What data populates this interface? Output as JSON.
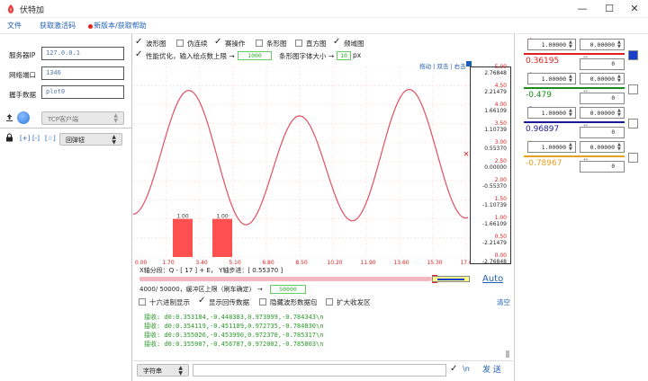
{
  "window": {
    "title": "伏特加",
    "buttons": {
      "min": "—",
      "max": "☐",
      "close": "✕"
    }
  },
  "menu": {
    "file": "文件",
    "activation": "获取激活码",
    "update": "新版本/获取帮助"
  },
  "connection": {
    "server_ip_label": "服务器IP",
    "server_ip_value": "127.0.0.1",
    "port_label": "网络端口",
    "port_value": "1346",
    "handshake_label": "握手数据",
    "handshake_value": "plot0",
    "tcp_mode": "TCP客户端"
  },
  "debug_buttons": {
    "plus": "[+]",
    "minus": "[-]",
    "star": "[☆]"
  },
  "popup_mode": "回弹钮",
  "plot_options": {
    "waveform": "波形图",
    "pseudo_continuous": "伪连续",
    "sin_op": "赛操作",
    "bar": "条形图",
    "histogram": "直方图",
    "spectrum": "频域图",
    "perf_label": "性能优化，输入绘点数上限 →",
    "perf_value": "1000",
    "bar_font_label": "条形图字体大小 →",
    "bar_font_value": "10",
    "bar_font_unit": "px"
  },
  "plot_links": "拖动 | 双击 | 右击",
  "bar_labels": [
    "1.00",
    "1.00"
  ],
  "x_axis": {
    "ticks": [
      "0.00",
      "1.70",
      "3.40",
      "5.10",
      "6.80",
      "8.50",
      "10.20",
      "11.90",
      "13.60",
      "15.30",
      "17.00"
    ],
    "info": "X轴分段：Q - [ 17 ] + E，  Y轴步进：[ 0.55370 ]"
  },
  "y_axis": {
    "ticks_red": [
      "5.00",
      "4.50",
      "4.00",
      "3.50",
      "3.00",
      "2.50",
      "2.00",
      "1.50",
      "1.00",
      "0.50",
      "0.00"
    ],
    "ticks_black": [
      "2.76848",
      "2.21479",
      "1.66109",
      "1.10739",
      "0.55370",
      "0.00000",
      "-0.55370",
      "-1.10739",
      "-1.66109",
      "-2.21479",
      "-2.76848"
    ]
  },
  "buffer": {
    "label": "4000/ 50000，缓冲区上限（刷车确定） →",
    "value": "50000",
    "auto": "Auto"
  },
  "recv_options": {
    "hex": "十六进制显示",
    "show_return": "显示回传数据",
    "hide_wave": "隐藏波形数据包",
    "expand": "扩大收发区",
    "clear": "清空"
  },
  "recv_lines": [
    "接收: d0:0.353184,-0.448383,0.973099,-0.784343\\n",
    "接收: d0:0.354119,-0.451189,0.972735,-0.784830\\n",
    "接收: d0:0.355026,-0.453990,0.972370,-0.785317\\n",
    "接收: d0:0.355907,-0.456787,0.972002,-0.785803\\n"
  ],
  "send": {
    "mode": "字符串",
    "newline": "\\n",
    "send_label": "发 送"
  },
  "channels": [
    {
      "idx": "0",
      "scale": "1.00000",
      "offset": "0.00000",
      "value": "0.36195",
      "ymin": "0",
      "color": "#e02020",
      "check_color": "#1a3fcc"
    },
    {
      "idx": "1",
      "scale": "1.00000",
      "offset": "0.00000",
      "value": "-0.479",
      "ymin": "0",
      "color": "#1a8a1a",
      "check_color": "#ffffff"
    },
    {
      "idx": "2",
      "scale": "1.00000",
      "offset": "0.00000",
      "value": "0.96897",
      "ymin": "0",
      "color": "#1a1a99",
      "check_color": "#ffffff"
    },
    {
      "idx": "3",
      "scale": "1.00000",
      "offset": "0.00000",
      "value": "-0.78967",
      "ymin": "0",
      "color": "#e8a020",
      "check_color": "#ffffff"
    }
  ],
  "colors": {
    "accent": "#1f5fb6",
    "wave": "#e02020",
    "bars": "#ff5050",
    "grid": "#ffd0d0"
  }
}
